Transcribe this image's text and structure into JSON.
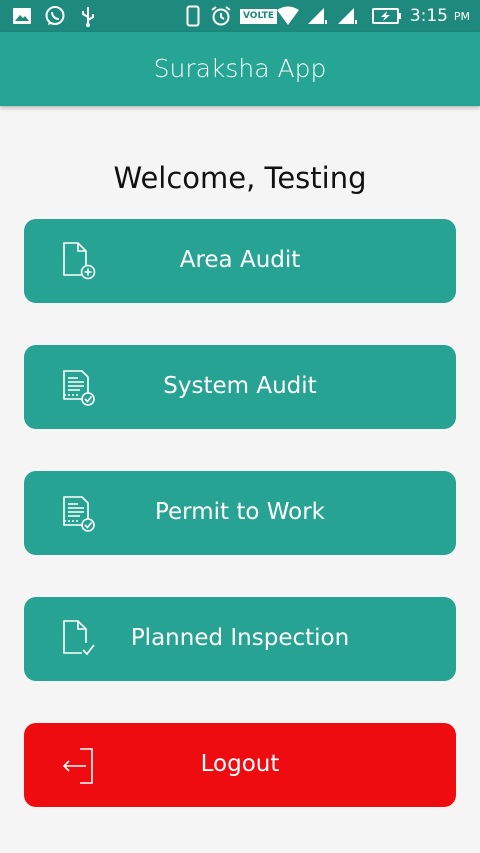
{
  "status_bar": {
    "time": "3:15",
    "ampm": "PM",
    "volte": "VOLTE",
    "icons": [
      "gallery-icon",
      "whatsapp-icon",
      "usb-icon",
      "phone-vibrate-icon",
      "alarm-icon",
      "volte-icon",
      "wifi-icon",
      "signal-1-icon",
      "signal-2-icon",
      "battery-charging-icon"
    ]
  },
  "app_bar": {
    "title": "Suraksha App"
  },
  "welcome": "Welcome, Testing",
  "menu": {
    "area_audit": "Area Audit",
    "system_audit": "System Audit",
    "permit_to_work": "Permit to Work",
    "planned_inspection": "Planned Inspection",
    "logout": "Logout"
  },
  "colors": {
    "status_bar": "#1d8a7d",
    "primary": "#26a595",
    "button": "#27a394",
    "logout": "#ee0c10",
    "background": "#f5f5f5"
  }
}
